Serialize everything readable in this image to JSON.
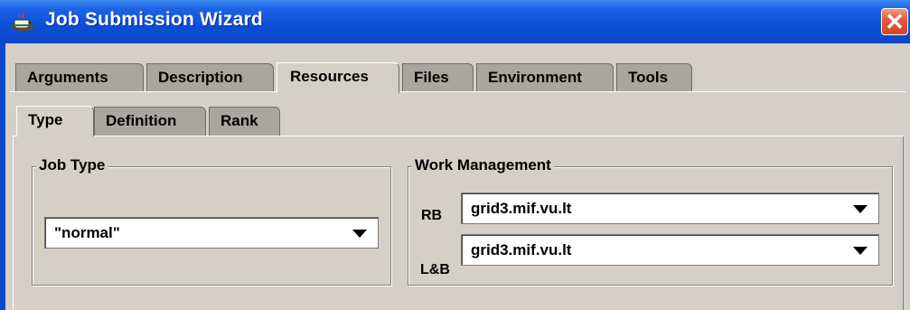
{
  "window": {
    "title": "Job Submission Wizard",
    "close_glyph": "✕"
  },
  "main_tabs": [
    {
      "label": "Arguments",
      "active": false
    },
    {
      "label": "Description",
      "active": false
    },
    {
      "label": "Resources",
      "active": true
    },
    {
      "label": "Files",
      "active": false
    },
    {
      "label": "Environment",
      "active": false
    },
    {
      "label": "Tools",
      "active": false
    }
  ],
  "sub_tabs": [
    {
      "label": "Type",
      "active": true
    },
    {
      "label": "Definition",
      "active": false
    },
    {
      "label": "Rank",
      "active": false
    }
  ],
  "job_type": {
    "title": "Job Type",
    "value": "\"normal\""
  },
  "work_management": {
    "title": "Work Management",
    "rb": {
      "label": "RB",
      "value": "grid3.mif.vu.lt"
    },
    "lb": {
      "label": "L&B",
      "value": "grid3.mif.vu.lt"
    }
  },
  "icons": {
    "title_icon": "java-cup-icon",
    "dropdown_icon": "chevron-down-icon"
  },
  "colors": {
    "title_bar": "#0a4ad0",
    "close_button": "#e45a3c",
    "background": "#d4d0c8"
  }
}
